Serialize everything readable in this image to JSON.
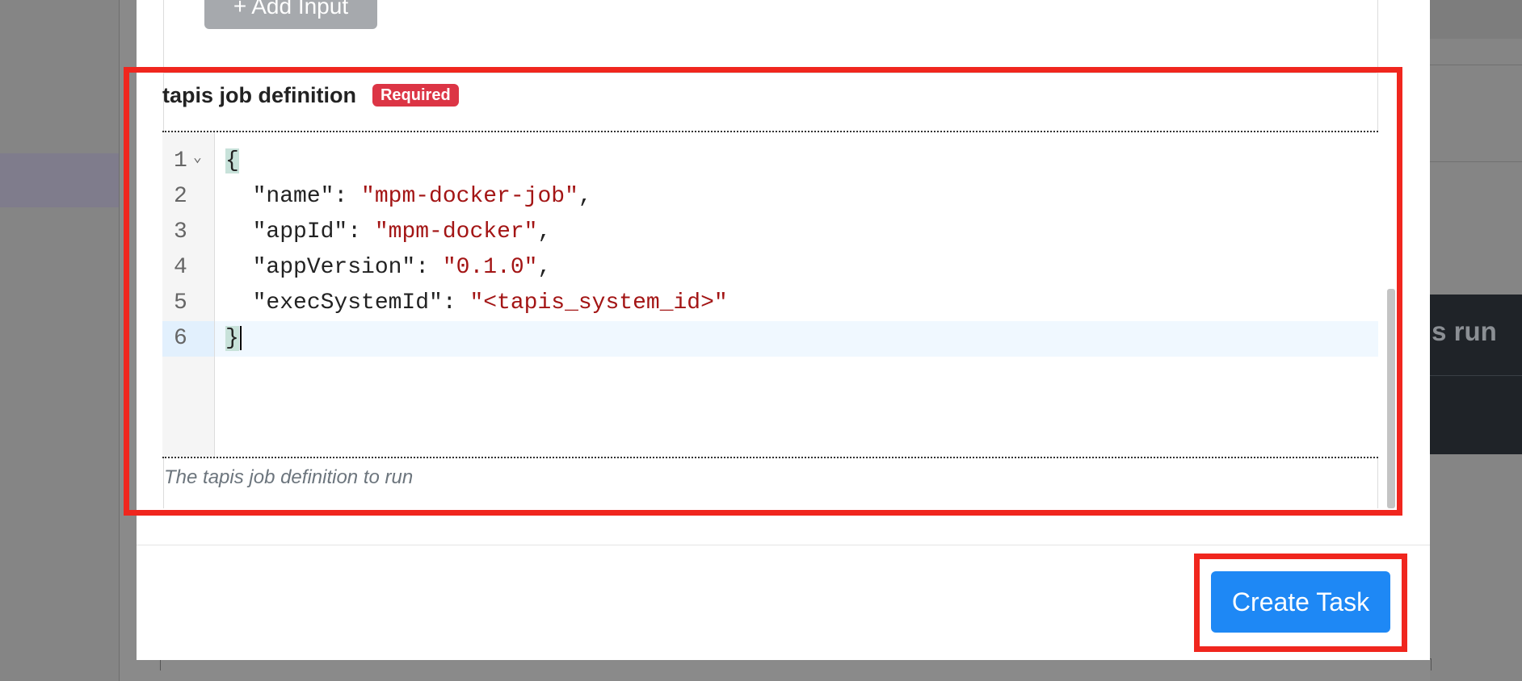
{
  "background": {
    "partial_text_right": "us run"
  },
  "form": {
    "add_input_label": "Add Input",
    "field": {
      "label": "tapis job definition",
      "required_badge": "Required",
      "help_text": "The tapis job definition to run"
    },
    "editor": {
      "line_numbers": [
        "1",
        "2",
        "3",
        "4",
        "5",
        "6"
      ],
      "lines": [
        {
          "segments": [
            {
              "t": "{",
              "c": "brace"
            }
          ]
        },
        {
          "segments": [
            {
              "t": "  \"name\": ",
              "c": "key"
            },
            {
              "t": "\"mpm-docker-job\"",
              "c": "str"
            },
            {
              "t": ",",
              "c": "key"
            }
          ]
        },
        {
          "segments": [
            {
              "t": "  \"appId\": ",
              "c": "key"
            },
            {
              "t": "\"mpm-docker\"",
              "c": "str"
            },
            {
              "t": ",",
              "c": "key"
            }
          ]
        },
        {
          "segments": [
            {
              "t": "  \"appVersion\": ",
              "c": "key"
            },
            {
              "t": "\"0.1.0\"",
              "c": "str"
            },
            {
              "t": ",",
              "c": "key"
            }
          ]
        },
        {
          "segments": [
            {
              "t": "  \"execSystemId\": ",
              "c": "key"
            },
            {
              "t": "\"<tapis_system_id>\"",
              "c": "str"
            }
          ]
        },
        {
          "segments": [
            {
              "t": "}",
              "c": "brace"
            }
          ]
        }
      ],
      "active_line": 6
    }
  },
  "footer": {
    "create_task_label": "Create Task"
  },
  "colors": {
    "primary": "#1e88f5",
    "danger": "#dc3545",
    "annotation": "#f0261e",
    "string": "#a31515"
  }
}
